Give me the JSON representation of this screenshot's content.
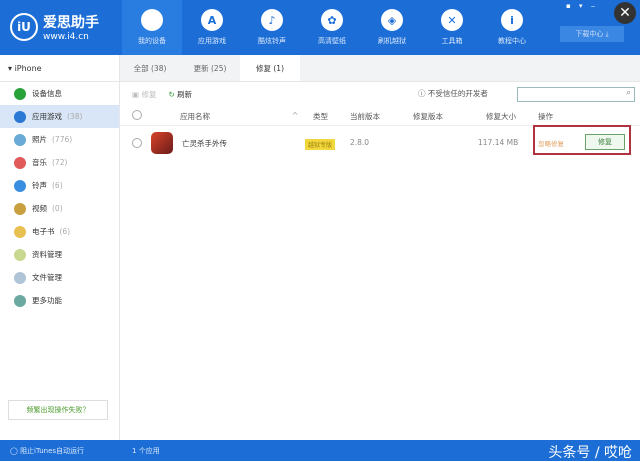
{
  "header": {
    "logo_name": "爱思助手",
    "logo_url": "www.i4.cn",
    "nav": [
      {
        "label": "我的设备",
        "icon": ""
      },
      {
        "label": "应用游戏",
        "icon": "A"
      },
      {
        "label": "酷炫铃声",
        "icon": "♪"
      },
      {
        "label": "高清壁纸",
        "icon": "✿"
      },
      {
        "label": "刷机越狱",
        "icon": "◈"
      },
      {
        "label": "工具箱",
        "icon": "✕"
      },
      {
        "label": "教程中心",
        "icon": "i"
      }
    ],
    "download": "下载中心 ⤓",
    "close": "✕"
  },
  "sidebar": {
    "device": "iPhone",
    "items": [
      {
        "label": "设备信息",
        "count": "",
        "color": "#2aa23a"
      },
      {
        "label": "应用游戏",
        "count": "(38)",
        "color": "#2b78d4"
      },
      {
        "label": "照片",
        "count": "(776)",
        "color": "#6aaad8"
      },
      {
        "label": "音乐",
        "count": "(72)",
        "color": "#e05a5a"
      },
      {
        "label": "铃声",
        "count": "(6)",
        "color": "#3a8ee0"
      },
      {
        "label": "视频",
        "count": "(0)",
        "color": "#c8a040"
      },
      {
        "label": "电子书",
        "count": "(6)",
        "color": "#e8c050"
      },
      {
        "label": "资料管理",
        "count": "",
        "color": "#c8d890"
      },
      {
        "label": "文件管理",
        "count": "",
        "color": "#b0c4d8"
      },
      {
        "label": "更多功能",
        "count": "",
        "color": "#6aa8a0"
      }
    ],
    "help": "频繁出现操作失败？"
  },
  "tabs": [
    "全部 (38)",
    "更新 (25)",
    "修复 (1)"
  ],
  "toolbar": {
    "repair": "修复",
    "refresh": "刷新",
    "untrusted": "不受信任的开发者",
    "search_placeholder": ""
  },
  "table": {
    "headers": [
      "应用名称",
      "类型",
      "当前版本",
      "修复版本",
      "修复大小",
      "操作"
    ],
    "rows": [
      {
        "name": "亡灵杀手外传",
        "type": "越狱专版",
        "current": "2.8.0",
        "repair_version": "",
        "size": "117.14 MB",
        "ignore": "忽略修复",
        "action": "修复"
      }
    ]
  },
  "status": {
    "itunes": "阻止iTunes自动运行",
    "count": "1 个应用",
    "watermark": "头条号 / 哎呛"
  }
}
